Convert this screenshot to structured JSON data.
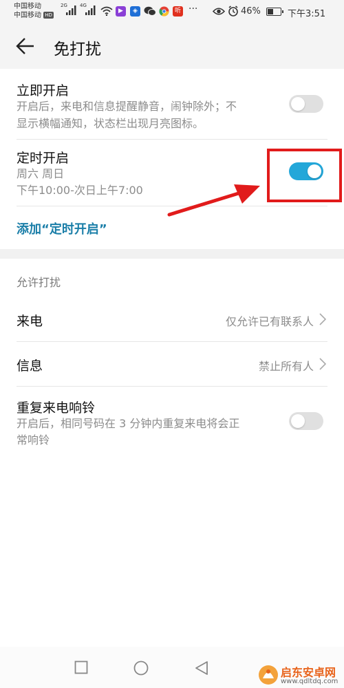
{
  "status_bar": {
    "carrier1": "中国移动",
    "carrier2": "中国移动",
    "hd_badge": "HD",
    "net1": "2G",
    "net2": "4G",
    "app_badge_label": "听",
    "more": "···",
    "battery_percent": "46%",
    "time": "下午3:51",
    "battery_level": 0.46,
    "icons": [
      "signal-icon",
      "wifi-icon",
      "video-app-icon",
      "shield-app-icon",
      "wechat-icon",
      "chrome-icon",
      "eye-icon",
      "alarm-icon",
      "battery-icon"
    ]
  },
  "header": {
    "title": "免打扰"
  },
  "settings": {
    "instant": {
      "title": "立即开启",
      "desc_line1": "开启后，来电和信息提醒静音，闹钟除外；不",
      "desc_line2": "显示横幅通知，状态栏出现月亮图标。",
      "enabled": false
    },
    "scheduled": {
      "title": "定时开启",
      "days": "周六 周日",
      "time_range": "下午10:00-次日上午7:00",
      "enabled": true
    },
    "add_schedule": "添加“定时开启”"
  },
  "allow": {
    "section_label": "允许打扰",
    "calls": {
      "title": "来电",
      "value": "仅允许已有联系人"
    },
    "messages": {
      "title": "信息",
      "value": "禁止所有人"
    },
    "repeat": {
      "title": "重复来电响铃",
      "desc_line1": "开启后，相同号码在 3 分钟内重复来电将会正",
      "desc_line2": "常响铃",
      "enabled": false
    }
  },
  "watermark": {
    "name": "启东安卓网",
    "url": "www.qdltdq.com"
  },
  "colors": {
    "accent": "#23a7d9",
    "link": "#1a7ea8",
    "annotation_red": "#e11b1b"
  }
}
